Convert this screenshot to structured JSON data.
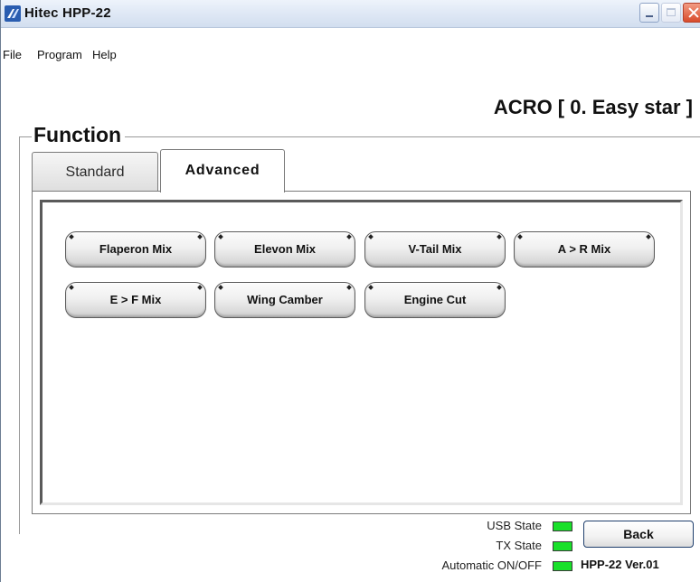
{
  "window": {
    "title": "Hitec HPP-22"
  },
  "menu": {
    "items": [
      "File",
      "Program",
      "Help"
    ]
  },
  "header": {
    "mode_title": "ACRO [ 0. Easy star ]"
  },
  "function_group": {
    "title": "Function",
    "tabs": [
      {
        "label": "Standard",
        "selected": false
      },
      {
        "label": "Advanced",
        "selected": true
      }
    ],
    "buttons": [
      {
        "label": "Flaperon Mix"
      },
      {
        "label": "Elevon Mix"
      },
      {
        "label": "V-Tail Mix"
      },
      {
        "label": "A > R Mix"
      },
      {
        "label": "E > F Mix"
      },
      {
        "label": "Wing Camber"
      },
      {
        "label": "Engine Cut"
      }
    ]
  },
  "status": {
    "usb_state_label": "USB State",
    "tx_state_label": "TX State",
    "auto_label": "Automatic ON/OFF",
    "led_color": "#19e02a",
    "back_label": "Back",
    "version": "HPP-22 Ver.01"
  }
}
